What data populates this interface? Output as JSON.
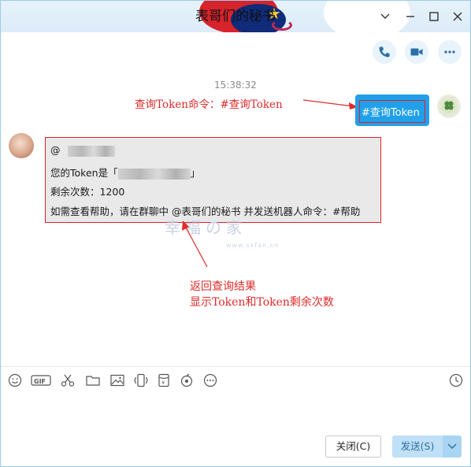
{
  "window": {
    "title": "表哥们的秘书",
    "controls": {
      "dropdown": "chevron-down-icon",
      "minimize": "minimize-icon",
      "maximize": "maximize-icon",
      "close": "close-icon"
    }
  },
  "header_actions": [
    {
      "name": "voice-call",
      "icon": "phone-icon"
    },
    {
      "name": "video-call",
      "icon": "video-icon"
    },
    {
      "name": "more",
      "icon": "more-icon"
    }
  ],
  "chat": {
    "timestamp": "15:38:32",
    "outgoing": {
      "text": "#查询Token"
    },
    "incoming": {
      "at_prefix": "@",
      "token_label": "您的Token是「",
      "token_suffix": "」",
      "remaining": "剩余次数：1200",
      "help": "如需查看帮助，请在群聊中 @表哥们的秘书  并发送机器人命令：#帮助"
    }
  },
  "annotations": {
    "query_note": "查询Token命令：#查询Token",
    "result_line1": "返回查询结果",
    "result_line2": "显示Token和Token剩余次数"
  },
  "watermark": {
    "title": "幸福の家",
    "subtitle": "www.sxfan.cn"
  },
  "toolbar": [
    "emoji-icon",
    "gif-icon",
    "scissors-icon",
    "folder-icon",
    "image-icon",
    "shake-icon",
    "redpacket-icon",
    "music-icon",
    "more-icon",
    "history-icon"
  ],
  "footer": {
    "close_label": "关闭(C)",
    "send_label": "发送(S)"
  },
  "colors": {
    "accent": "#20a0ea",
    "annotation": "#e02a2a",
    "bubble_in": "#e9e9ea"
  }
}
